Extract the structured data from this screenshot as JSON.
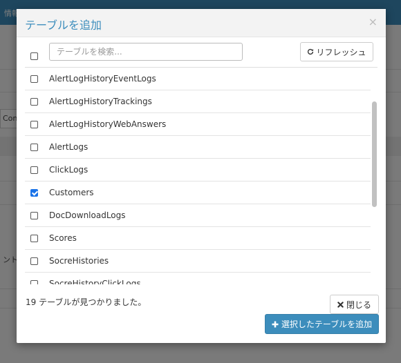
{
  "background": {
    "topbar_text": "情報",
    "row_text_1": "Con",
    "row_text_2": "ント"
  },
  "modal": {
    "title": "テーブルを追加",
    "close_symbol": "×",
    "search": {
      "placeholder": "テーブルを検索...",
      "value": ""
    },
    "refresh_label": "リフレッシュ",
    "select_all_checked": false,
    "tables": [
      {
        "name": "AlertLogHistoryEventLogs",
        "checked": false
      },
      {
        "name": "AlertLogHistoryTrackings",
        "checked": false
      },
      {
        "name": "AlertLogHistoryWebAnswers",
        "checked": false
      },
      {
        "name": "AlertLogs",
        "checked": false
      },
      {
        "name": "ClickLogs",
        "checked": false
      },
      {
        "name": "Customers",
        "checked": true
      },
      {
        "name": "DocDownloadLogs",
        "checked": false
      },
      {
        "name": "Scores",
        "checked": false
      },
      {
        "name": "SocreHistories",
        "checked": false
      },
      {
        "name": "SocreHistoryClickLogs",
        "checked": false
      }
    ],
    "found_text": "19 テーブルが見つかりました。",
    "close_label": "閉じる",
    "add_label": "選択したテーブルを追加"
  },
  "colors": {
    "accent": "#3c8dbc",
    "checkbox_checked": "#1a73e8"
  }
}
